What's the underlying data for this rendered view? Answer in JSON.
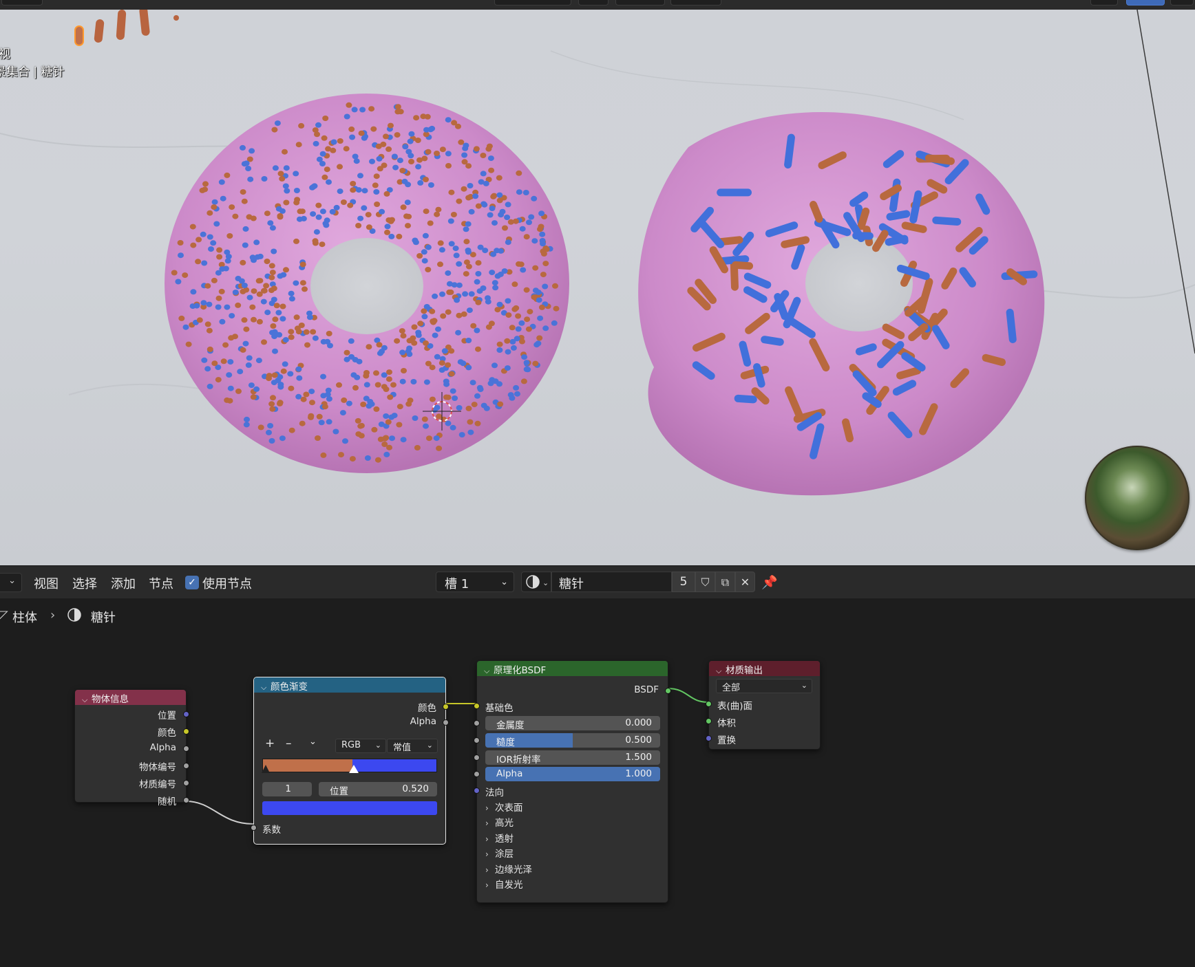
{
  "viewport": {
    "mode_label": "视",
    "collection_label": "景集合 | 糖针"
  },
  "header": {
    "menu": [
      "视图",
      "选择",
      "添加",
      "节点"
    ],
    "use_nodes_label": "使用节点",
    "use_nodes_checked": true,
    "slot_label": "槽 1",
    "material_name": "糖针",
    "user_count": "5"
  },
  "breadcrumb": {
    "object": "柱体",
    "material": "糖针"
  },
  "nodes": {
    "object_info": {
      "title": "物体信息",
      "outputs": [
        "位置",
        "颜色",
        "Alpha",
        "物体编号",
        "材质编号",
        "随机"
      ]
    },
    "color_ramp": {
      "title": "颜色渐变",
      "outputs": [
        "颜色",
        "Alpha"
      ],
      "add_label": "+",
      "remove_label": "–",
      "color_mode": "RGB",
      "interpolation": "常值",
      "stop_colors": [
        "#c0704a",
        "#3c48f0"
      ],
      "active_index": "1",
      "position_label": "位置",
      "position_value": "0.520",
      "input_label": "系数"
    },
    "principled_bsdf": {
      "title": "原理化BSDF",
      "output": "BSDF",
      "base_color_label": "基础色",
      "metallic": {
        "label": "金属度",
        "value": "0.000",
        "fraction": 0.0
      },
      "roughness": {
        "label": "糙度",
        "value": "0.500",
        "fraction": 0.5
      },
      "ior": {
        "label": "IOR折射率",
        "value": "1.500"
      },
      "alpha": {
        "label": "Alpha",
        "value": "1.000",
        "fraction": 1.0
      },
      "normal_label": "法向",
      "panels": [
        "次表面",
        "高光",
        "透射",
        "涂层",
        "边缘光泽",
        "自发光"
      ]
    },
    "material_output": {
      "title": "材质输出",
      "target": "全部",
      "inputs": [
        "表(曲)面",
        "体积",
        "置换"
      ]
    }
  },
  "colors": {
    "object_info_header": "#83314a",
    "color_ramp_header": "#246283",
    "bsdf_header": "#2b652b",
    "output_header": "#5e1f2c",
    "accent": "#4772b3"
  }
}
